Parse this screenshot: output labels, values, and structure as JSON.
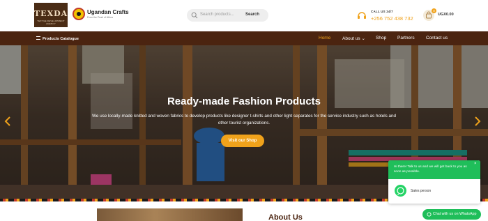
{
  "header": {
    "logo_texda": "TEXDA",
    "logo_texda_tag": "TEXTILE DEVELOPMENT AGENCY",
    "uc_name": "Ugandan Crafts",
    "uc_tagline": "From the Pearl of Africa",
    "search_placeholder": "Search products...",
    "search_button": "Search",
    "call_label": "CALL US 24/7",
    "call_number": "+256 752 438 732",
    "cart_count": "0",
    "cart_total": "UGX0.00"
  },
  "nav": {
    "catalogue": "Products Catalogue",
    "items": [
      {
        "label": "Home",
        "active": true
      },
      {
        "label": "About us ⌄",
        "active": false
      },
      {
        "label": "Shop",
        "active": false
      },
      {
        "label": "Partners",
        "active": false
      },
      {
        "label": "Contact us",
        "active": false
      }
    ]
  },
  "hero": {
    "title": "Ready-made Fashion Products",
    "text": "We use locally-made knitted and woven fabrics to develop products like designer t-shirts and other light separates for the service industry such as hotels and other tourist organizations.",
    "button": "Visit our Shop"
  },
  "about": {
    "title": "About Us"
  },
  "whatsapp": {
    "message": "Hi there! Talk to us and we will get back to you as soon as possible.",
    "person": "Sales person",
    "chat_button": "Chat with us on WhatsApp",
    "close": "×"
  },
  "colors": {
    "brown": "#4b2410",
    "accent": "#f0a21b",
    "whatsapp_green": "#1fbe5a"
  }
}
